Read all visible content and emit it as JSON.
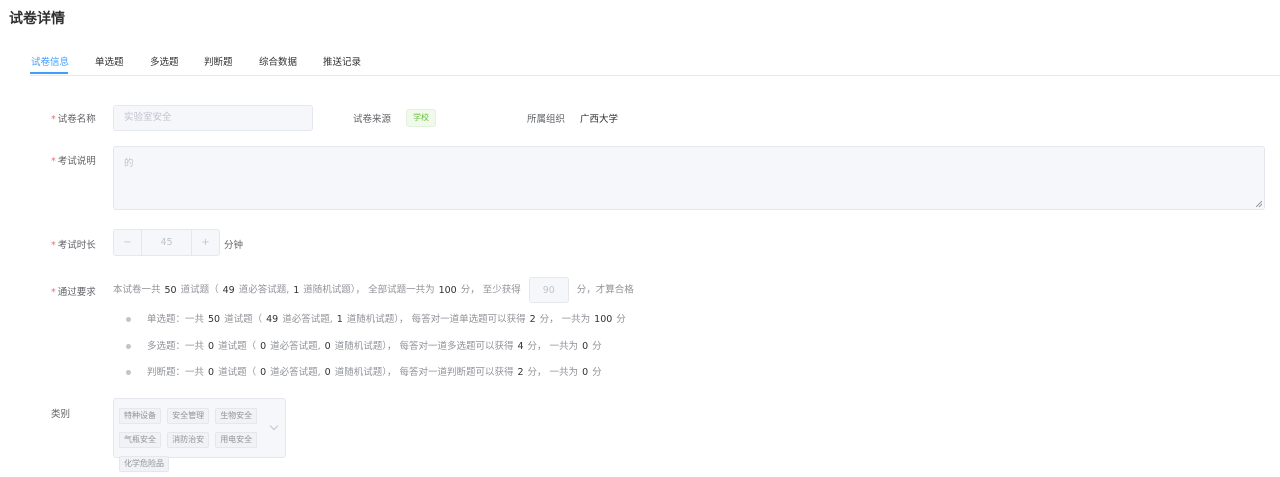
{
  "page": {
    "title": "试卷详情"
  },
  "tabs": [
    {
      "label": "试卷信息"
    },
    {
      "label": "单选题"
    },
    {
      "label": "多选题"
    },
    {
      "label": "判断题"
    },
    {
      "label": "综合数据"
    },
    {
      "label": "推送记录"
    }
  ],
  "form": {
    "name_label": "试卷名称",
    "name_placeholder": "实验室安全",
    "source_label": "试卷来源",
    "source_tag": "学校",
    "org_label": "所属组织",
    "org_value": "广西大学",
    "desc_label": "考试说明",
    "desc_placeholder": "的",
    "duration_label": "考试时长",
    "duration_minus": "−",
    "duration_value": "45",
    "duration_plus": "+",
    "duration_unit": "分钟",
    "pass_label": "通过要求",
    "pass": {
      "t1": "本试卷一共",
      "total": "50",
      "t2": "道试题（",
      "required": "49",
      "t3": "道必答试题,",
      "random": "1",
      "t4": "道随机试题）， 全部试题一共为",
      "total_score": "100",
      "t5": "分， 至少获得",
      "min_score": "90",
      "t6": "分，才算合格"
    },
    "rows": [
      {
        "name": "单选题：一共",
        "count": "50",
        "a": "道试题（",
        "req": "49",
        "b": "道必答试题,",
        "rand": "1",
        "c": "道随机试题）， 每答对一道单选题可以获得",
        "per": "2",
        "d": "分， 一共为",
        "sum": "100",
        "e": "分"
      },
      {
        "name": "多选题：一共",
        "count": "0",
        "a": "道试题（",
        "req": "0",
        "b": "道必答试题,",
        "rand": "0",
        "c": "道随机试题）， 每答对一道多选题可以获得",
        "per": "4",
        "d": "分， 一共为",
        "sum": "0",
        "e": "分"
      },
      {
        "name": "判断题：一共",
        "count": "0",
        "a": "道试题（",
        "req": "0",
        "b": "道必答试题,",
        "rand": "0",
        "c": "道随机试题）， 每答对一道判断题可以获得",
        "per": "2",
        "d": "分， 一共为",
        "sum": "0",
        "e": "分"
      }
    ],
    "category_label": "类别",
    "categories": [
      "特种设备",
      "安全管理",
      "生物安全",
      "气瓶安全",
      "消防治安",
      "用电安全",
      "化学危险品"
    ]
  },
  "colors": {
    "accent": "#409eff",
    "required": "#f56c6c",
    "tag_green": "#67c23a"
  }
}
